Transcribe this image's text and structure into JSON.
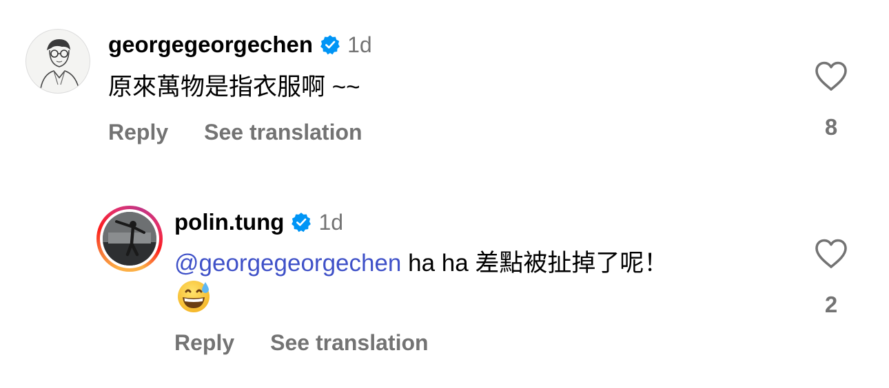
{
  "comments": [
    {
      "username": "georgegeorgechen",
      "verified": true,
      "timestamp": "1d",
      "text": "原來萬物是指衣服啊 ~~",
      "reply_label": "Reply",
      "translate_label": "See translation",
      "likes": "8"
    },
    {
      "username": "polin.tung",
      "verified": true,
      "timestamp": "1d",
      "mention": "@georgegeorgechen",
      "text": "ha ha 差點被扯掉了呢！",
      "emoji": "grinning-face-with-sweat",
      "reply_label": "Reply",
      "translate_label": "See translation",
      "likes": "2",
      "has_story": true
    }
  ],
  "colors": {
    "verified_badge": "#0095f6",
    "secondary_text": "#737373",
    "mention": "#3f51c8"
  }
}
